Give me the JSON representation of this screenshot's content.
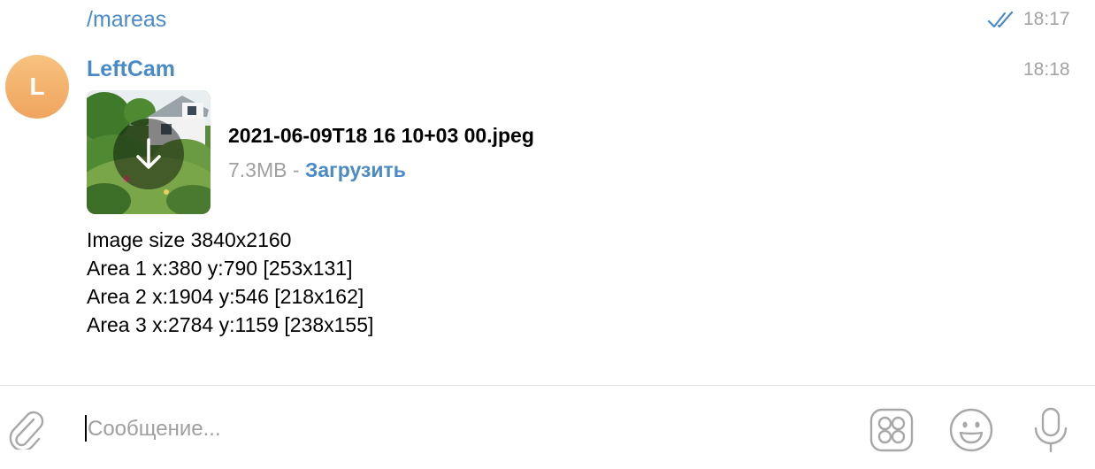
{
  "messages": [
    {
      "text": "/mareas",
      "time": "18:17",
      "status_icon": "double-check-icon"
    },
    {
      "avatar_letter": "L",
      "sender": "LeftCam",
      "time": "18:18",
      "file": {
        "name": "2021-06-09T18 16 10+03 00.jpeg",
        "size": "7.3MB",
        "separator": " - ",
        "download_label": "Загрузить",
        "thumbnail_icon": "download-arrow-icon"
      },
      "lines": [
        "Image size 3840x2160",
        "Area 1 x:380 y:790 [253x131]",
        "Area 2 x:1904 y:546 [218x162]",
        "Area 3 x:2784 y:1159 [238x155]"
      ]
    }
  ],
  "composer": {
    "placeholder": "Сообщение...",
    "value": ""
  },
  "colors": {
    "accent": "#4a8ac8",
    "time": "#a3a3a3",
    "avatar_gradient": [
      "#f7c27f",
      "#f0a45e"
    ],
    "icons": "#a8a8a8"
  }
}
